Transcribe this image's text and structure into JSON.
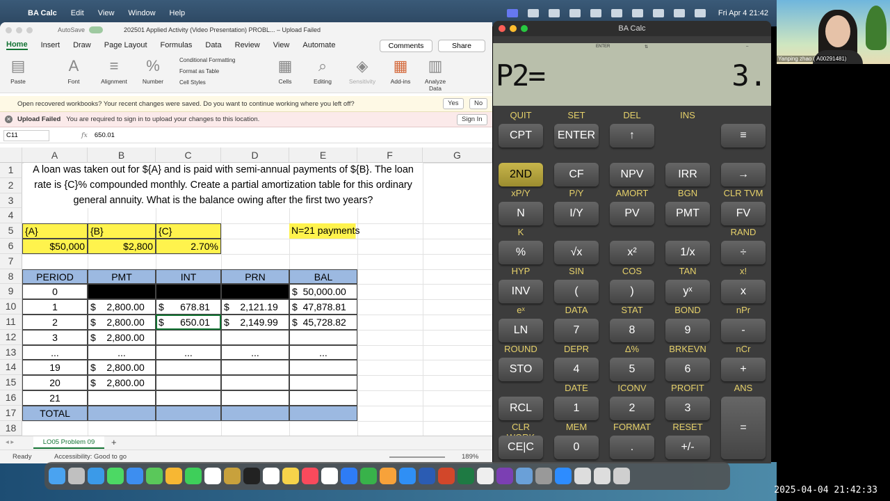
{
  "menubar": {
    "app": "BA Calc",
    "items": [
      "Edit",
      "View",
      "Window",
      "Help"
    ],
    "clock": "Fri Apr 4  21:42"
  },
  "excel": {
    "autosave": "AutoSave",
    "doc_title": "202501 Applied Activity (Video Presentation) PROBL... – Upload Failed",
    "tabs": [
      "Home",
      "Insert",
      "Draw",
      "Page Layout",
      "Formulas",
      "Data",
      "Review",
      "View",
      "Automate"
    ],
    "comments": "Comments",
    "share": "Share",
    "ribbon": {
      "paste": "Paste",
      "font": "Font",
      "alignment": "Alignment",
      "number": "Number",
      "cond_format": "Conditional Formatting",
      "format_table": "Format as Table",
      "cell_styles": "Cell Styles",
      "cells": "Cells",
      "editing": "Editing",
      "sensitivity": "Sensitivity",
      "addins": "Add-ins",
      "analyze": "Analyze Data"
    },
    "notice1": {
      "text": "Open recovered workbooks?  Your recent changes were saved. Do you want to continue working where you left off?",
      "yes": "Yes",
      "no": "No"
    },
    "notice2": {
      "title": "Upload Failed",
      "text": "You are required to sign in to upload your changes to this location.",
      "signin": "Sign In"
    },
    "namebox": "C11",
    "fx": "fx",
    "formula": "650.01",
    "columns": [
      "A",
      "B",
      "C",
      "D",
      "E",
      "F",
      "G"
    ],
    "rows": [
      "1",
      "2",
      "3",
      "4",
      "5",
      "6",
      "7",
      "8",
      "9",
      "10",
      "11",
      "12",
      "13",
      "14",
      "15",
      "16",
      "17",
      "18"
    ],
    "problem": "A loan was taken out for ${A} and is paid with semi-annual payments of ${B}. The loan rate is {C}% compounded monthly. Create a partial amortization table for this ordinary general annuity. What is the balance owing after the first two years?",
    "labels": {
      "a": "{A}",
      "b": "{B}",
      "c": "{C}",
      "n": "N=21 payments"
    },
    "inputs": {
      "a": "$50,000",
      "b": "$2,800",
      "c": "2.70%"
    },
    "table_headers": [
      "PERIOD",
      "PMT",
      "INT",
      "PRN",
      "BAL"
    ],
    "table_rows": [
      [
        "0",
        "",
        "",
        "",
        "$  50,000.00"
      ],
      [
        "1",
        "$    2,800.00",
        "$      678.81",
        "$    2,121.19",
        "$  47,878.81"
      ],
      [
        "2",
        "$    2,800.00",
        "$      650.01",
        "$    2,149.99",
        "$  45,728.82"
      ],
      [
        "3",
        "$    2,800.00",
        "",
        "",
        ""
      ],
      [
        "...",
        "...",
        "...",
        "...",
        "..."
      ],
      [
        "19",
        "$    2,800.00",
        "",
        "",
        ""
      ],
      [
        "20",
        "$    2,800.00",
        "",
        "",
        ""
      ],
      [
        "21",
        "",
        "",
        "",
        ""
      ]
    ],
    "total": "TOTAL",
    "sheet_tab": "LO05 Problem 09",
    "add_sheet": "+",
    "status_ready": "Ready",
    "status_access": "Accessibility: Good to go",
    "zoom": "189%"
  },
  "calc": {
    "title": "BA Calc",
    "indicators": {
      "enter": "ENTER",
      "updown": "⇅",
      "minus": "–"
    },
    "display_label": "P2=",
    "display_value": "3.",
    "rows": [
      {
        "top": [
          "QUIT",
          "SET",
          "DEL",
          "INS",
          ""
        ],
        "keys": [
          "CPT",
          "ENTER",
          "↑",
          "",
          "≡"
        ]
      },
      {
        "top": [
          "",
          "",
          "",
          "",
          ""
        ],
        "keys": [
          "2ND",
          "CF",
          "NPV",
          "IRR",
          "→"
        ]
      },
      {
        "top": [
          "xP/Y",
          "P/Y",
          "AMORT",
          "BGN",
          "CLR TVM"
        ],
        "keys": [
          "N",
          "I/Y",
          "PV",
          "PMT",
          "FV"
        ]
      },
      {
        "top": [
          "K",
          "",
          "",
          "",
          "RAND"
        ],
        "keys": [
          "%",
          "√x",
          "x²",
          "1/x",
          "÷"
        ]
      },
      {
        "top": [
          "HYP",
          "SIN",
          "COS",
          "TAN",
          "x!"
        ],
        "keys": [
          "INV",
          "(",
          ")",
          "yˣ",
          "x"
        ]
      },
      {
        "top": [
          "eˣ",
          "DATA",
          "STAT",
          "BOND",
          "nPr"
        ],
        "keys": [
          "LN",
          "7",
          "8",
          "9",
          "-"
        ]
      },
      {
        "top": [
          "ROUND",
          "DEPR",
          "Δ%",
          "BRKEVN",
          "nCr"
        ],
        "keys": [
          "STO",
          "4",
          "5",
          "6",
          "+"
        ]
      },
      {
        "top": [
          "",
          "DATE",
          "ICONV",
          "PROFIT",
          "ANS"
        ],
        "keys": [
          "RCL",
          "1",
          "2",
          "3",
          ""
        ]
      },
      {
        "top": [
          "CLR WORK",
          "MEM",
          "FORMAT",
          "RESET",
          ""
        ],
        "keys": [
          "CE|C",
          "0",
          ".",
          "+/-",
          ""
        ]
      }
    ],
    "equals": "="
  },
  "webcam": {
    "name": "Yanping zhao ( A00291481)"
  },
  "timestamp": "2025-04-04  21:42:33"
}
